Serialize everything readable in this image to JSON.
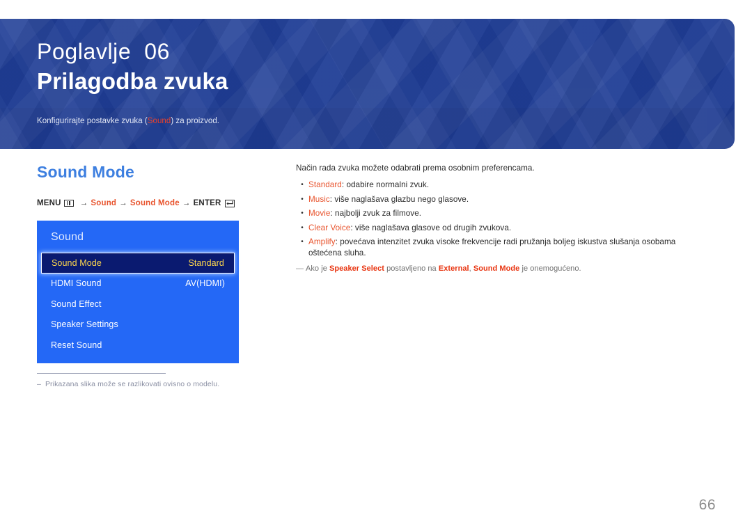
{
  "banner": {
    "chapter_label": "Poglavlje  06",
    "chapter_title": "Prilagodba zvuka",
    "subtitle_before": "Konfigurirajte postavke zvuka (",
    "subtitle_highlight": "Sound",
    "subtitle_after": ") za proizvod.",
    "background_color": "#1f3d96",
    "highlight_color": "#e8422c"
  },
  "section": {
    "title": "Sound Mode",
    "title_color": "#3d7fe0"
  },
  "breadcrumb": {
    "menu_label": "MENU",
    "menu_icon": "menu-grid-icon",
    "arrow": "→",
    "step1": "Sound",
    "step2": "Sound Mode",
    "enter_label": "ENTER",
    "enter_icon": "enter-key-icon",
    "accent_color": "#e8542e"
  },
  "osd": {
    "title": "Sound",
    "background_color": "#2468f6",
    "selected_bg": "#0a1a70",
    "selected_text_color": "#ffd84d",
    "rows": [
      {
        "label": "Sound Mode",
        "value": "Standard",
        "selected": true
      },
      {
        "label": "HDMI Sound",
        "value": "AV(HDMI)",
        "selected": false
      },
      {
        "label": "Sound Effect",
        "value": "",
        "selected": false
      },
      {
        "label": "Speaker Settings",
        "value": "",
        "selected": false
      },
      {
        "label": "Reset Sound",
        "value": "",
        "selected": false
      }
    ]
  },
  "footnote": {
    "dash": "–",
    "text": "Prikazana slika može se razlikovati ovisno o modelu."
  },
  "description": {
    "intro": "Način rada zvuka možete odabrati prema osobnim preferencama.",
    "bullet_marker": "•",
    "bullets": [
      {
        "term": "Standard",
        "rest": ": odabire normalni zvuk."
      },
      {
        "term": "Music",
        "rest": ": više naglašava glazbu nego glasove."
      },
      {
        "term": "Movie",
        "rest": ": najbolji zvuk za filmove."
      },
      {
        "term": "Clear Voice",
        "rest": ": više naglašava glasove od drugih zvukova."
      },
      {
        "term": "Amplify",
        "rest": ": povećava intenzitet zvuka visoke frekvencije radi pružanja boljeg iskustva slušanja osobama oštećena sluha."
      }
    ],
    "note": {
      "dash": "—",
      "part1": "Ako je ",
      "strong1": "Speaker Select",
      "part2": " postavljeno na ",
      "strong2": "External",
      "part3": ", ",
      "strong3": "Sound Mode",
      "part4": " je onemogućeno."
    }
  },
  "page_number": "66"
}
